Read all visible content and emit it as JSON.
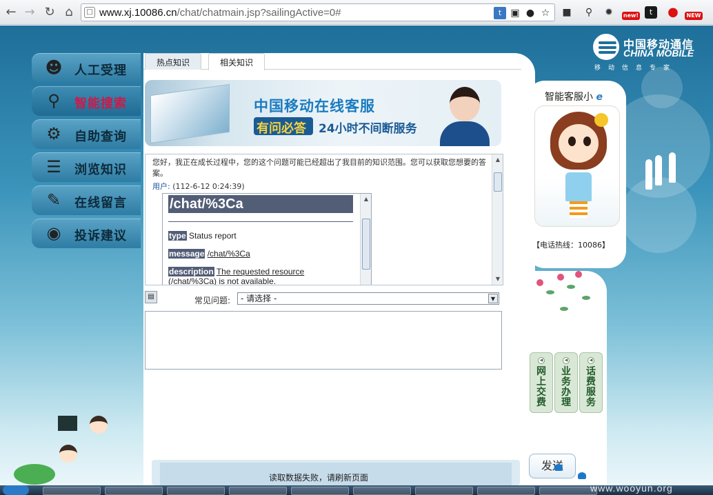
{
  "browser": {
    "url_host": "www.xj.10086.cn",
    "url_path": "/chat/chatmain.jsp?sailingActive=0#"
  },
  "logo": {
    "cn": "中国移动通信",
    "en": "CHINA MOBILE",
    "tagline": "移动信息专家"
  },
  "menu": [
    {
      "label": "人工受理",
      "icon": "customer-service-icon"
    },
    {
      "label": "智能搜索",
      "icon": "magnifier-icon"
    },
    {
      "label": "自助查询",
      "icon": "query-icon"
    },
    {
      "label": "浏览知识",
      "icon": "book-icon"
    },
    {
      "label": "在线留言",
      "icon": "notepad-icon"
    },
    {
      "label": "投诉建议",
      "icon": "globe-icon"
    }
  ],
  "tabs": [
    "热点知识",
    "相关知识"
  ],
  "banner": {
    "title": "中国移动在线客服",
    "slogan_a": "有问必答",
    "slogan_b": "24小时不间断服务"
  },
  "chat": {
    "system_text": "您好，我正在成长过程中，您的这个问题可能已经超出了我目前的知识范围。您可以获取您想要的答案。",
    "user_label": "用户:",
    "user_time": "(112-6-12 0:24:39)",
    "error": {
      "title": "/chat/%3Ca",
      "type_key": "type",
      "type_val": "Status report",
      "message_key": "message",
      "message_val": "/chat/%3Ca",
      "description_key": "description",
      "description_val_1": "The requested resource",
      "description_val_2": "(/chat/%3Ca) is not available."
    }
  },
  "faq": {
    "label": "常见问题:",
    "selected": "- 请选择 -"
  },
  "bottom_status": "读取数据失败，请刷新页面",
  "assistant": {
    "title": "智能客服小",
    "title_e": "e",
    "hotline": "【电话热线：10086】"
  },
  "side_buttons": [
    {
      "label": "网上交费"
    },
    {
      "label": "业务办理"
    },
    {
      "label": "话费服务"
    }
  ],
  "send_label": "发送",
  "watermark": "www.wooyun.org",
  "colors": {
    "accent": "#1e6f9a",
    "active_menu_text": "#cc1a4a",
    "error_header": "#525d76"
  }
}
